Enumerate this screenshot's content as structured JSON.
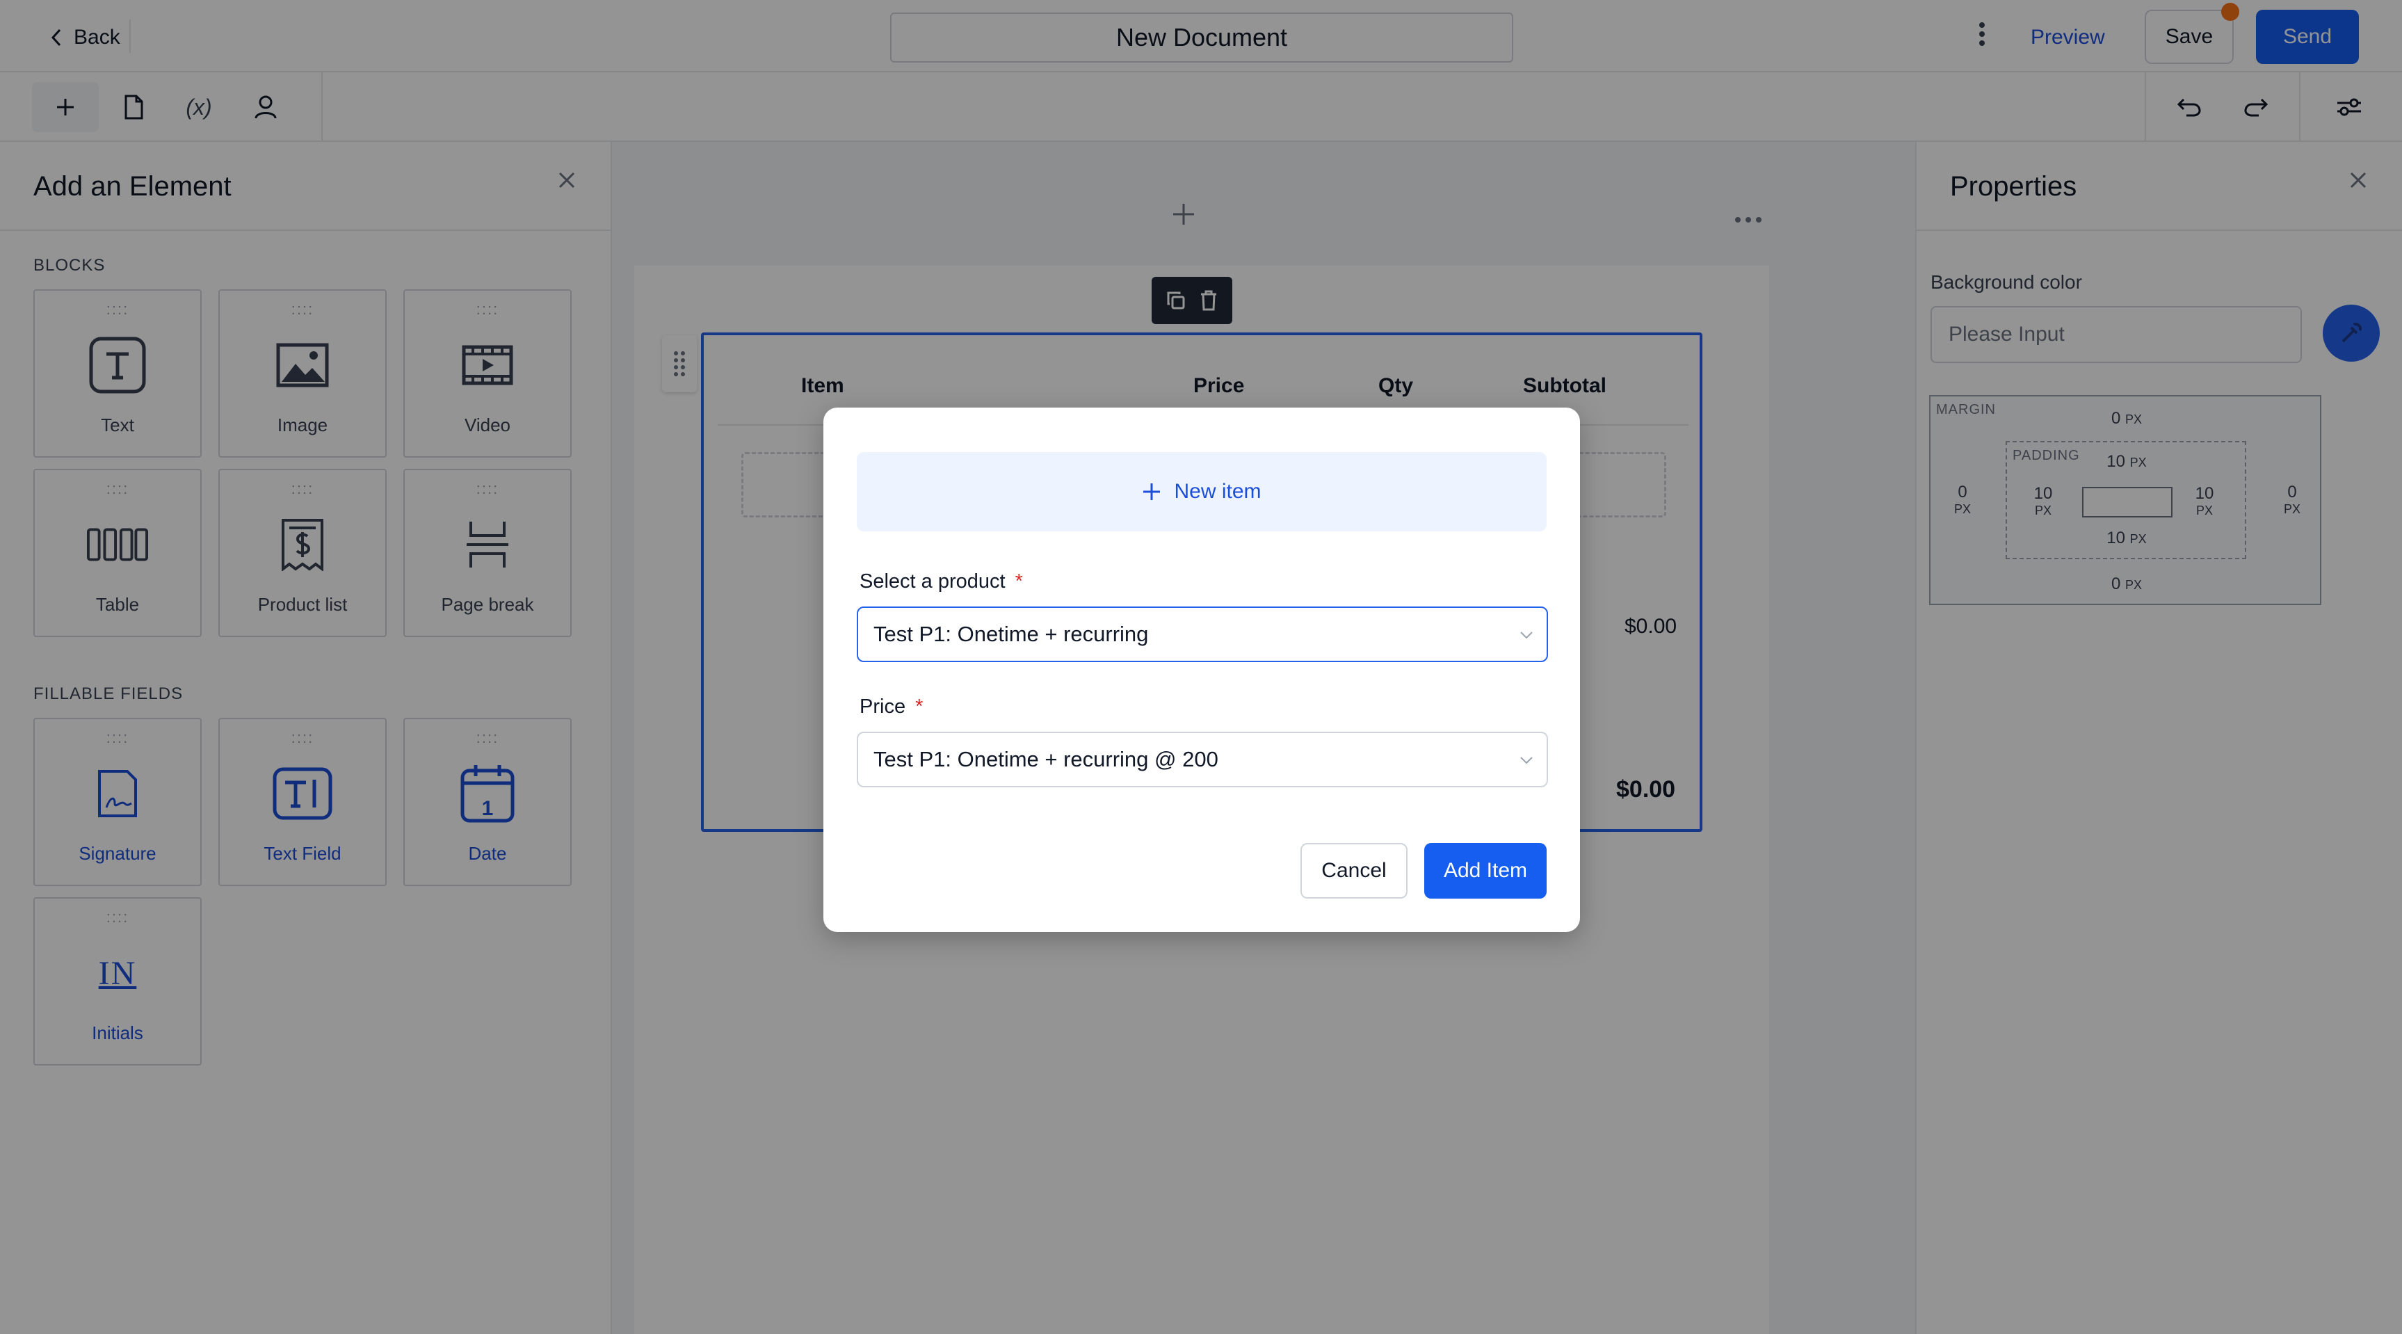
{
  "header": {
    "back_label": "Back",
    "document_title": "New Document",
    "preview_label": "Preview",
    "save_label": "Save",
    "send_label": "Send",
    "icons": [
      "chevron-left-icon",
      "kebab-icon",
      "unsaved-dot"
    ]
  },
  "toolbar": {
    "variable_label": "(x)",
    "icons": [
      "plus-icon",
      "document-icon",
      "variable-icon",
      "user-icon",
      "undo-icon",
      "redo-icon",
      "settings-sliders-icon"
    ]
  },
  "left_panel": {
    "title": "Add an Element",
    "blocks_label": "BLOCKS",
    "blocks": [
      {
        "label": "Text",
        "icon": "text-icon"
      },
      {
        "label": "Image",
        "icon": "image-icon"
      },
      {
        "label": "Video",
        "icon": "video-icon"
      },
      {
        "label": "Table",
        "icon": "table-icon"
      },
      {
        "label": "Product list",
        "icon": "product-list-icon"
      },
      {
        "label": "Page break",
        "icon": "page-break-icon"
      }
    ],
    "fillable_label": "FILLABLE FIELDS",
    "fillable": [
      {
        "label": "Signature",
        "icon": "signature-icon"
      },
      {
        "label": "Text Field",
        "icon": "text-field-icon"
      },
      {
        "label": "Date",
        "icon": "date-icon"
      },
      {
        "label": "Initials",
        "icon": "initials-icon"
      }
    ],
    "date_icon_number": "1",
    "initials_icon_text": "IN"
  },
  "canvas": {
    "table": {
      "headers": [
        "Item",
        "Price",
        "Qty",
        "Subtotal"
      ],
      "row_price": "$0.00",
      "total": "$0.00"
    }
  },
  "right_panel": {
    "title": "Properties",
    "background_label": "Background color",
    "background_placeholder": "Please Input",
    "spacing": {
      "margin_label": "MARGIN",
      "padding_label": "PADDING",
      "margin_top": "0",
      "margin_bottom": "0",
      "margin_left": "0",
      "margin_right": "0",
      "padding_top": "10",
      "padding_bottom": "10",
      "padding_left": "10",
      "padding_right": "10",
      "unit": "PX"
    }
  },
  "modal": {
    "new_item_label": "New item",
    "product_label": "Select a product",
    "product_value": "Test P1: Onetime + recurring",
    "price_label": "Price",
    "price_value": "Test P1: Onetime + recurring @ 200",
    "required_mark": "*",
    "cancel_label": "Cancel",
    "add_label": "Add Item"
  },
  "colors": {
    "accent": "#155eef",
    "link": "#1d4ed8",
    "overlay": "rgba(0,0,0,0.42)",
    "required": "#dc2626",
    "unsaved_dot": "#f97316"
  }
}
